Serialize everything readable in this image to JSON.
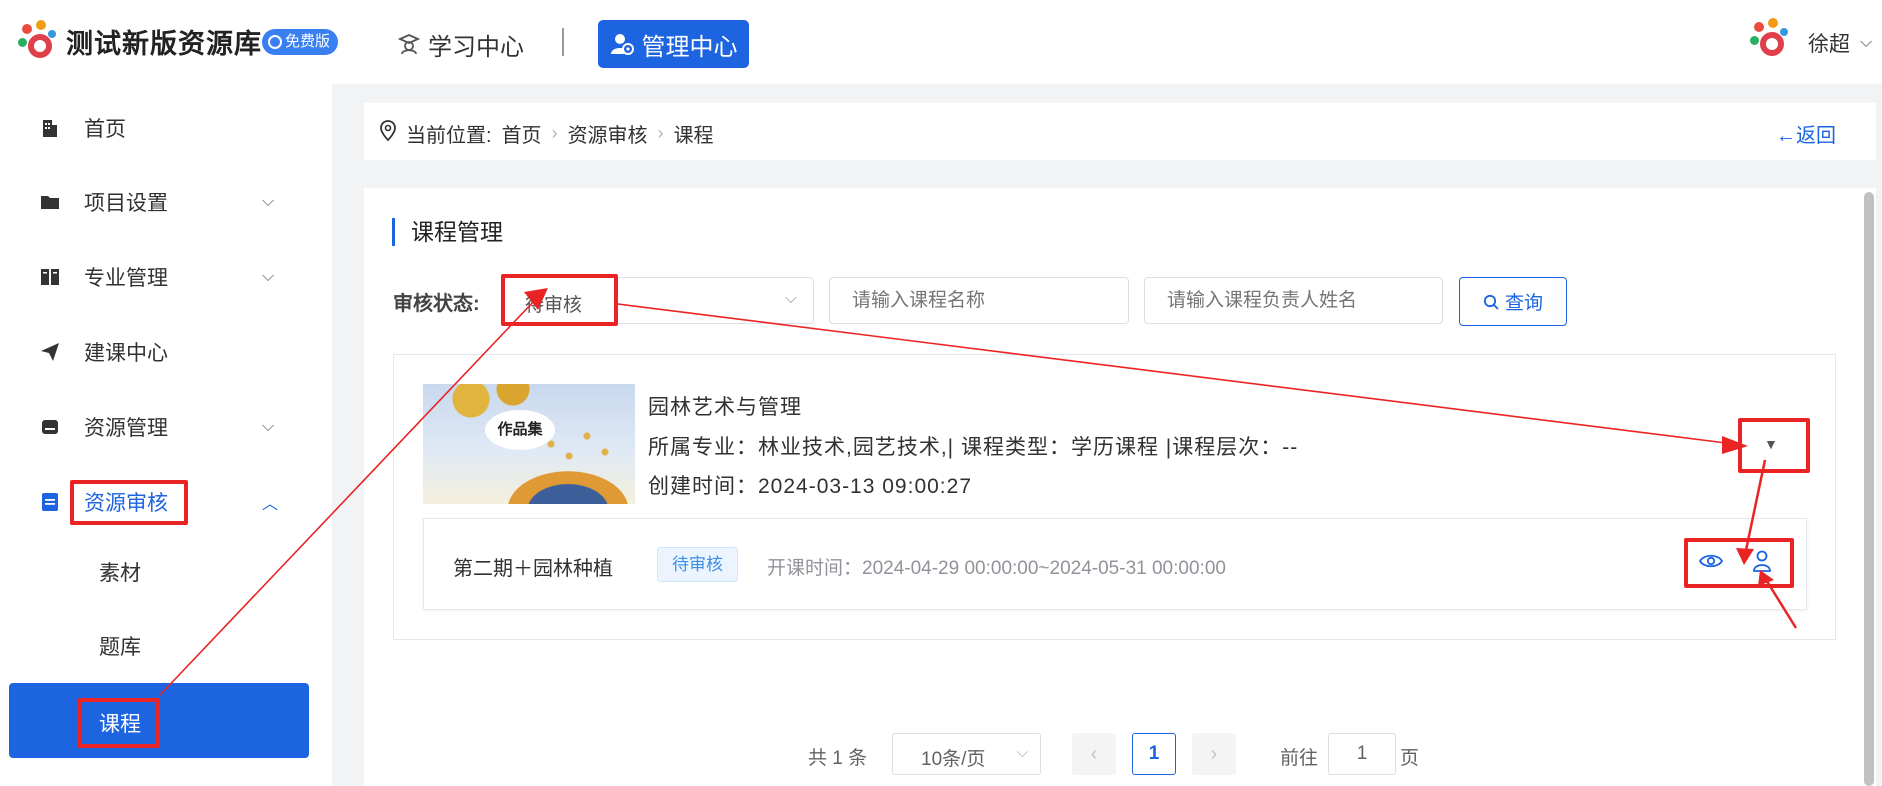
{
  "header": {
    "app_title": "测试新版资源库",
    "badge": "免费版",
    "nav_learn": "学习中心",
    "nav_admin": "管理中心",
    "user_name": "徐超"
  },
  "sidebar": {
    "items": [
      {
        "label": "首页",
        "icon": "building-icon"
      },
      {
        "label": "项目设置",
        "icon": "folder-icon"
      },
      {
        "label": "专业管理",
        "icon": "book-icon"
      },
      {
        "label": "建课中心",
        "icon": "paper-plane-icon"
      },
      {
        "label": "资源管理",
        "icon": "drive-icon"
      },
      {
        "label": "资源审核",
        "icon": "audit-icon"
      }
    ],
    "sub_items": [
      "素材",
      "题库",
      "课程"
    ]
  },
  "breadcrumb": {
    "prefix": "当前位置:",
    "items": [
      "首页",
      "资源审核",
      "课程"
    ],
    "back": "←返回"
  },
  "main": {
    "section_title": "课程管理",
    "filter_label": "审核状态:",
    "status_value": "待审核",
    "course_name_placeholder": "请输入课程名称",
    "owner_placeholder": "请输入课程负责人姓名",
    "search_label": "查询"
  },
  "course": {
    "thumb_text": "作品集",
    "name": "园林艺术与管理",
    "meta": "所属专业：林业技术,园艺技术,| 课程类型：学历课程 |课程层次：--",
    "created": "创建时间：2024-03-13 09:00:27",
    "period": {
      "name": "第二期＋园林种植",
      "status": "待审核",
      "time": "开课时间：2024-04-29 00:00:00~2024-05-31 00:00:00"
    }
  },
  "pagination": {
    "total": "共 1 条",
    "page_size": "10条/页",
    "current": "1",
    "goto_label": "前往",
    "goto_value": "1",
    "page_suffix": "页"
  },
  "colors": {
    "accent": "#1c64e0",
    "annotation": "#ea2424"
  }
}
